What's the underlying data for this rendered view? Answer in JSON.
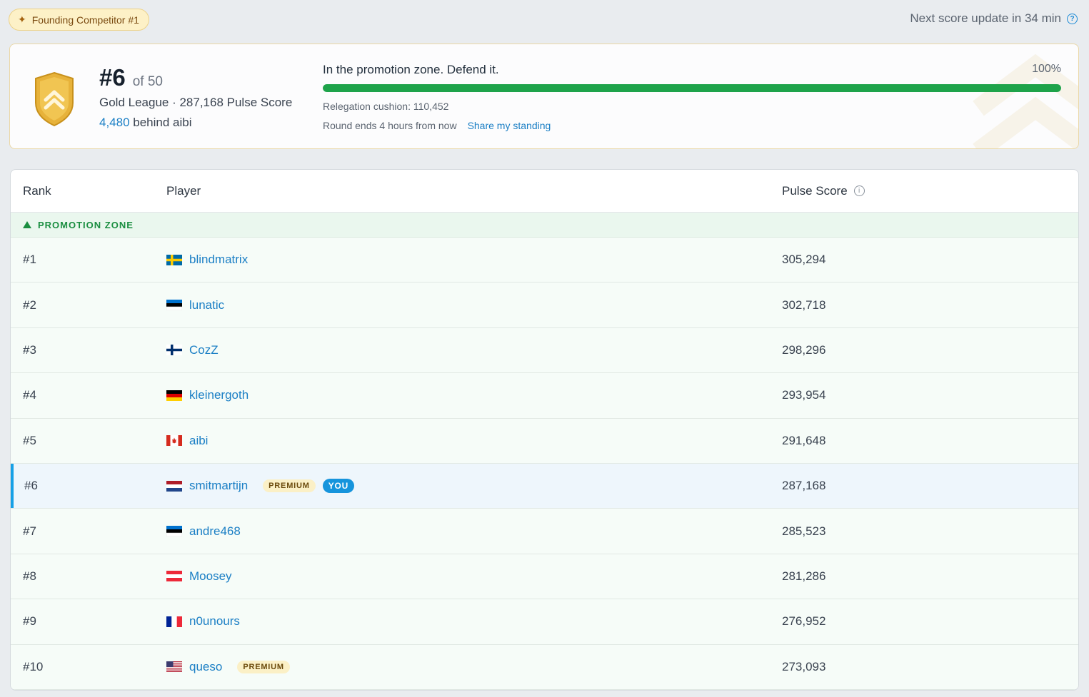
{
  "top": {
    "founder_badge": "Founding Competitor #1",
    "next_update": "Next score update in 34 min"
  },
  "standing": {
    "rank": "#6",
    "of": "of 50",
    "league_line": "Gold League · 287,168 Pulse Score",
    "behind_num": "4,480",
    "behind_text": " behind aibi",
    "zone_message": "In the promotion zone. Defend it.",
    "progress_pct_label": "100%",
    "progress_fraction": 1.0,
    "cushion": "Relegation cushion: 110,452",
    "round_ends": "Round ends 4 hours from now",
    "share_link": "Share my standing"
  },
  "table": {
    "headers": {
      "rank": "Rank",
      "player": "Player",
      "score": "Pulse Score"
    },
    "zone_label": "PROMOTION ZONE",
    "rows": [
      {
        "rank": "#1",
        "name": "blindmatrix",
        "flag": "se",
        "score": "305,294"
      },
      {
        "rank": "#2",
        "name": "lunatic",
        "flag": "ee",
        "score": "302,718"
      },
      {
        "rank": "#3",
        "name": "CozZ",
        "flag": "fi",
        "score": "298,296"
      },
      {
        "rank": "#4",
        "name": "kleinergoth",
        "flag": "de",
        "score": "293,954"
      },
      {
        "rank": "#5",
        "name": "aibi",
        "flag": "ca",
        "score": "291,648"
      },
      {
        "rank": "#6",
        "name": "smitmartijn",
        "flag": "nl",
        "score": "287,168",
        "premium": "PREMIUM",
        "you": "YOU"
      },
      {
        "rank": "#7",
        "name": "andre468",
        "flag": "ee",
        "score": "285,523"
      },
      {
        "rank": "#8",
        "name": "Moosey",
        "flag": "at",
        "score": "281,286"
      },
      {
        "rank": "#9",
        "name": "n0unours",
        "flag": "fr",
        "score": "276,952"
      },
      {
        "rank": "#10",
        "name": "queso",
        "flag": "us",
        "score": "273,093",
        "premium": "PREMIUM"
      }
    ]
  },
  "colors": {
    "accent": "#1b7fc5",
    "progress": "#1ea34a",
    "zone": "#1a8e40",
    "you_highlight": "#16a0e6"
  }
}
